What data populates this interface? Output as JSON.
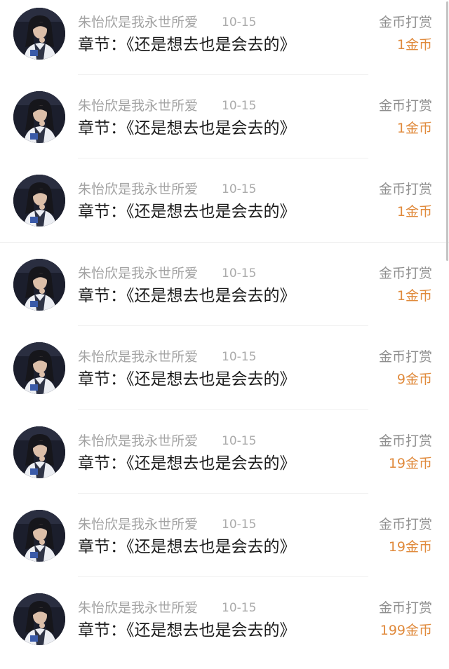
{
  "colors": {
    "name": "#a3a3a3",
    "chapter": "#1c1c1c",
    "reward_label": "#8e8e8e",
    "reward_amount": "#e08a3c",
    "divider": "#f0f0f0"
  },
  "avatar_icon": "user-avatar-photo",
  "items": [
    {
      "user": "朱怡欣是我永世所爱",
      "date": "10-15",
      "chapter": "章节：《还是想去也是会去的》",
      "reward_type": "金币打赏",
      "reward_amount": "1金币"
    },
    {
      "user": "朱怡欣是我永世所爱",
      "date": "10-15",
      "chapter": "章节：《还是想去也是会去的》",
      "reward_type": "金币打赏",
      "reward_amount": "1金币"
    },
    {
      "user": "朱怡欣是我永世所爱",
      "date": "10-15",
      "chapter": "章节：《还是想去也是会去的》",
      "reward_type": "金币打赏",
      "reward_amount": "1金币"
    },
    {
      "user": "朱怡欣是我永世所爱",
      "date": "10-15",
      "chapter": "章节：《还是想去也是会去的》",
      "reward_type": "金币打赏",
      "reward_amount": "1金币"
    },
    {
      "user": "朱怡欣是我永世所爱",
      "date": "10-15",
      "chapter": "章节：《还是想去也是会去的》",
      "reward_type": "金币打赏",
      "reward_amount": "9金币"
    },
    {
      "user": "朱怡欣是我永世所爱",
      "date": "10-15",
      "chapter": "章节：《还是想去也是会去的》",
      "reward_type": "金币打赏",
      "reward_amount": "19金币"
    },
    {
      "user": "朱怡欣是我永世所爱",
      "date": "10-15",
      "chapter": "章节：《还是想去也是会去的》",
      "reward_type": "金币打赏",
      "reward_amount": "19金币"
    },
    {
      "user": "朱怡欣是我永世所爱",
      "date": "10-15",
      "chapter": "章节：《还是想去也是会去的》",
      "reward_type": "金币打赏",
      "reward_amount": "199金币"
    }
  ]
}
